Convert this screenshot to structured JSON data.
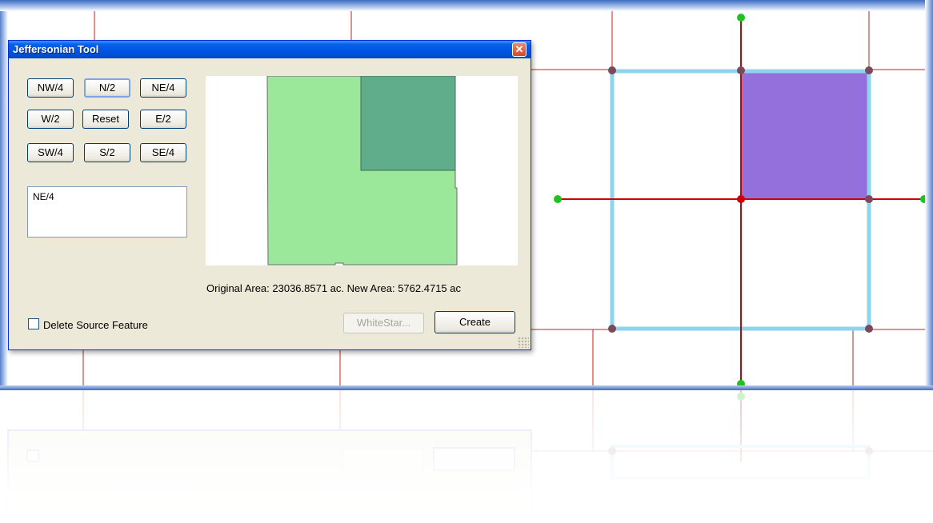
{
  "dialog": {
    "title": "Jeffersonian Tool",
    "close_glyph": "✕",
    "buttons": {
      "nw4": "NW/4",
      "n2": "N/2",
      "ne4": "NE/4",
      "w2": "W/2",
      "reset": "Reset",
      "e2": "E/2",
      "sw4": "SW/4",
      "s2": "S/2",
      "se4": "SE/4"
    },
    "selected_button": "N/2",
    "selection_list": [
      "NE/4"
    ],
    "area_text": "Original Area: 23036.8571 ac. New Area: 5762.4715 ac",
    "delete_source_label": "Delete Source Feature",
    "delete_source_checked": false,
    "whitestar_label": "WhiteStar...",
    "create_label": "Create"
  },
  "colors": {
    "preview_parcel": "#9be89b",
    "preview_selection": "#5fad8b",
    "map_selection_fill": "#9370db",
    "map_parcel_outline": "#8fd4ee",
    "grid_line": "#cc0000",
    "vertex_green": "#1fc21f",
    "vertex_dark": "#7a4a5a",
    "titlebar": "#0054e3"
  },
  "map": {
    "selected_quarter": "NE/4",
    "icons": [
      "vertex-node-icon",
      "section-line-icon"
    ]
  }
}
